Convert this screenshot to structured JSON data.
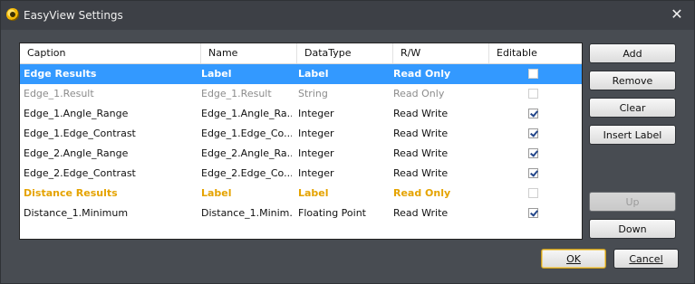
{
  "window": {
    "title": "EasyView Settings",
    "close_glyph": "✕"
  },
  "columns": [
    "Caption",
    "Name",
    "DataType",
    "R/W",
    "Editable"
  ],
  "rows": [
    {
      "caption": "Edge Results",
      "name": "Label",
      "type": "Label",
      "rw": "Read Only",
      "editable": false,
      "style": "selected"
    },
    {
      "caption": "Edge_1.Result",
      "name": "Edge_1.Result",
      "type": "String",
      "rw": "Read Only",
      "editable": false,
      "style": "grey"
    },
    {
      "caption": "Edge_1.Angle_Range",
      "name": "Edge_1.Angle_Ra...",
      "type": "Integer",
      "rw": "Read Write",
      "editable": true,
      "style": "normal"
    },
    {
      "caption": "Edge_1.Edge_Contrast",
      "name": "Edge_1.Edge_Co...",
      "type": "Integer",
      "rw": "Read Write",
      "editable": true,
      "style": "normal"
    },
    {
      "caption": "Edge_2.Angle_Range",
      "name": "Edge_2.Angle_Ra...",
      "type": "Integer",
      "rw": "Read Write",
      "editable": true,
      "style": "normal"
    },
    {
      "caption": "Edge_2.Edge_Contrast",
      "name": "Edge_2.Edge_Co...",
      "type": "Integer",
      "rw": "Read Write",
      "editable": true,
      "style": "normal"
    },
    {
      "caption": "Distance Results",
      "name": "Label",
      "type": "Label",
      "rw": "Read Only",
      "editable": false,
      "style": "group"
    },
    {
      "caption": "Distance_1.Minimum",
      "name": "Distance_1.Minim...",
      "type": "Floating Point",
      "rw": "Read Write",
      "editable": true,
      "style": "normal"
    }
  ],
  "buttons": {
    "add": "Add",
    "remove": "Remove",
    "clear": "Clear",
    "insert_label": "Insert Label",
    "up": "Up",
    "down": "Down",
    "ok": "OK",
    "cancel": "Cancel"
  },
  "colors": {
    "selection": "#3399ff",
    "group_text": "#e5a300",
    "disabled_text": "#8c8c8c",
    "dialog_bg": "#484c52"
  }
}
